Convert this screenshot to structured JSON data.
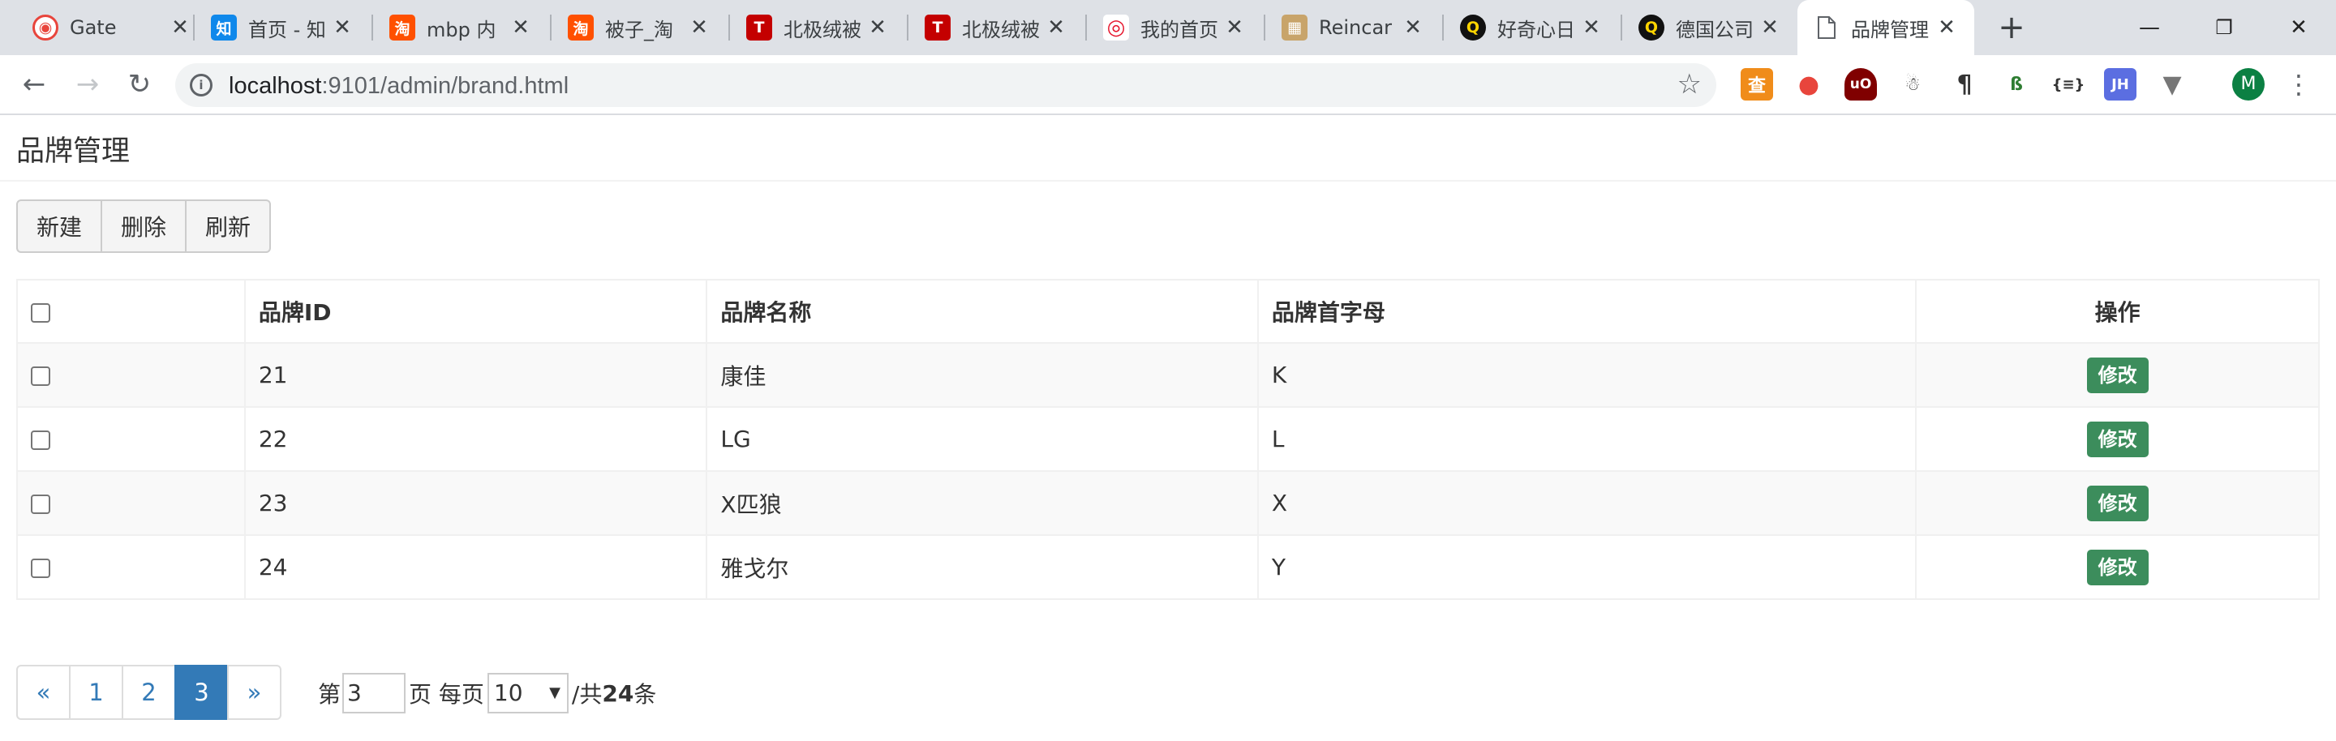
{
  "browser": {
    "tabs": [
      {
        "title": "Gate",
        "favicon_icon": "gate-icon",
        "favicon_text": "◉",
        "favicon_color": "#e8453c"
      },
      {
        "title": "首页 - 知",
        "favicon_icon": "zhihu-icon",
        "favicon_text": "知",
        "favicon_color": "#0f88eb"
      },
      {
        "title": "mbp 内",
        "favicon_icon": "taobao-icon",
        "favicon_text": "淘",
        "favicon_color": "#ff5000"
      },
      {
        "title": "被子_淘",
        "favicon_icon": "taobao-icon",
        "favicon_text": "淘",
        "favicon_color": "#ff5000"
      },
      {
        "title": "北极绒被",
        "favicon_icon": "tmall-icon",
        "favicon_text": "T",
        "favicon_color": "#c40000"
      },
      {
        "title": "北极绒被",
        "favicon_icon": "tmall-icon",
        "favicon_text": "T",
        "favicon_color": "#c40000"
      },
      {
        "title": "我的首页",
        "favicon_icon": "weibo-icon",
        "favicon_text": "◎",
        "favicon_color": "#e6162d"
      },
      {
        "title": "Reincar",
        "favicon_icon": "reincarnation-icon",
        "favicon_text": "▦",
        "favicon_color": "#c8a46a"
      },
      {
        "title": "好奇心日",
        "favicon_icon": "qdaily-icon",
        "favicon_text": "Q",
        "favicon_color": "#111111"
      },
      {
        "title": "德国公司",
        "favicon_icon": "qdaily-icon",
        "favicon_text": "Q",
        "favicon_color": "#111111"
      },
      {
        "title": "品牌管理",
        "favicon_icon": "document-icon",
        "favicon_text": "",
        "favicon_color": "#ffffff",
        "active": true
      }
    ],
    "url_host": "localhost",
    "url_rest": ":9101/admin/brand.html",
    "profile_initial": "M"
  },
  "page": {
    "title": "品牌管理",
    "toolbar": {
      "new_label": "新建",
      "delete_label": "删除",
      "refresh_label": "刷新"
    },
    "table": {
      "headers": {
        "id": "品牌ID",
        "name": "品牌名称",
        "letter": "品牌首字母",
        "op": "操作"
      },
      "rows": [
        {
          "id": "21",
          "name": "康佳",
          "letter": "K",
          "op": "修改"
        },
        {
          "id": "22",
          "name": "LG",
          "letter": "L",
          "op": "修改"
        },
        {
          "id": "23",
          "name": "X匹狼",
          "letter": "X",
          "op": "修改"
        },
        {
          "id": "24",
          "name": "雅戈尔",
          "letter": "Y",
          "op": "修改"
        }
      ]
    },
    "pagination": {
      "prev": "«",
      "pages": [
        "1",
        "2",
        "3"
      ],
      "next": "»",
      "current": "3",
      "label_di": "第",
      "current_page_value": "3",
      "label_ye": "页 每页",
      "page_size": "10",
      "label_total_prefix": "/共",
      "total": "24",
      "label_total_suffix": "条"
    },
    "colors": {
      "primary": "#337ab7",
      "edit_button": "#3c8d5c"
    }
  }
}
